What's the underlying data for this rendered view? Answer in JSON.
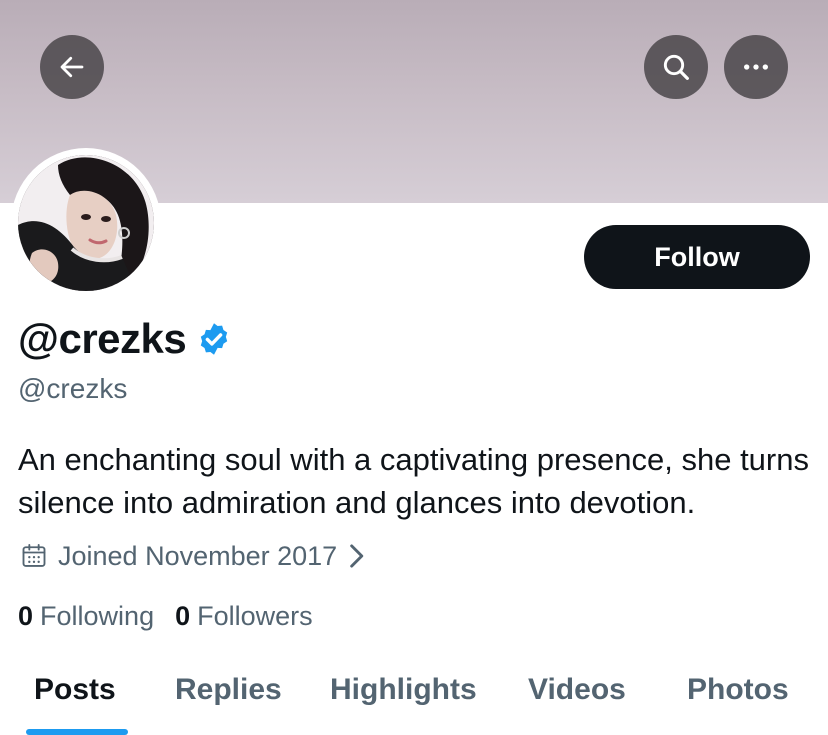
{
  "header": {
    "back_icon": "arrow-left-icon",
    "search_icon": "search-icon",
    "more_icon": "more-horizontal-icon",
    "banner_color": "#c7bcc5"
  },
  "profile": {
    "display_name": "@crezks",
    "verified": true,
    "verified_color": "#1d9bf0",
    "handle": "@crezks",
    "bio": "An enchanting soul with a captivating presence, she turns silence into admiration and glances into devotion.",
    "joined": "Joined November 2017",
    "follow_label": "Follow"
  },
  "stats": {
    "following_count": "0",
    "following_label": "Following",
    "followers_count": "0",
    "followers_label": "Followers"
  },
  "tabs": [
    {
      "label": "Posts",
      "active": true
    },
    {
      "label": "Replies",
      "active": false
    },
    {
      "label": "Highlights",
      "active": false
    },
    {
      "label": "Videos",
      "active": false
    },
    {
      "label": "Photos",
      "active": false
    }
  ],
  "colors": {
    "accent": "#1d9bf0",
    "text_primary": "#0f1419",
    "text_secondary": "#536471"
  }
}
